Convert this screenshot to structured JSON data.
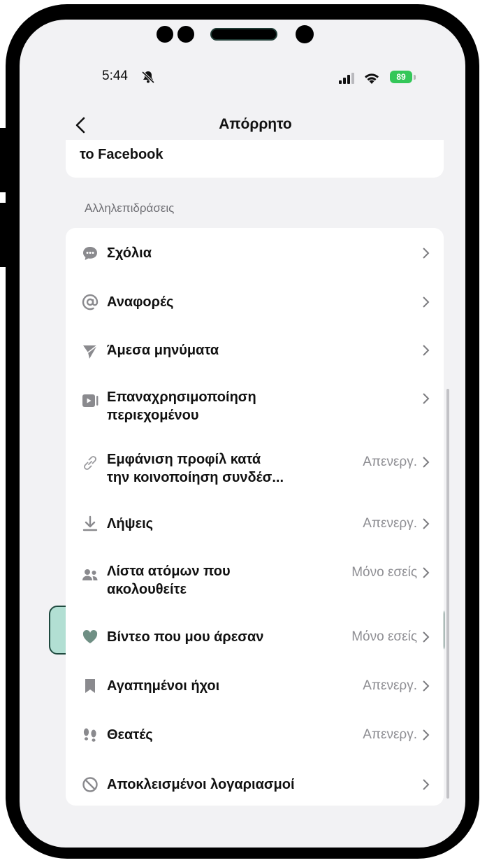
{
  "status_bar": {
    "time": "5:44",
    "battery": "89"
  },
  "nav": {
    "title": "Απόρρητο"
  },
  "top_card": {
    "text": "το Facebook"
  },
  "section": {
    "label": "Αλληλεπιδράσεις"
  },
  "rows": [
    {
      "label": "Σχόλια",
      "value": "",
      "icon": "comment-icon"
    },
    {
      "label": "Αναφορές",
      "value": "",
      "icon": "at-icon"
    },
    {
      "label": "Άμεσα μηνύματα",
      "value": "",
      "icon": "send-icon"
    },
    {
      "label": "Επαναχρησιμοποίηση\nπεριεχομένου",
      "value": "",
      "icon": "reuse-video-icon"
    },
    {
      "label": "Εμφάνιση προφίλ κατά\nτην κοινοποίηση συνδέσ...",
      "value": "Απενεργ.",
      "icon": "link-icon"
    },
    {
      "label": "Λήψεις",
      "value": "Απενεργ.",
      "icon": "download-icon"
    },
    {
      "label": "Λίστα ατόμων που\nακολουθείτε",
      "value": "Μόνο εσείς",
      "icon": "people-icon"
    },
    {
      "label": "Βίντεο που μου άρεσαν",
      "value": "Μόνο εσείς",
      "icon": "heart-icon"
    },
    {
      "label": "Αγαπημένοι ήχοι",
      "value": "Απενεργ.",
      "icon": "bookmark-icon"
    },
    {
      "label": "Θεατές",
      "value": "Απενεργ.",
      "icon": "footprints-icon"
    },
    {
      "label": "Αποκλεισμένοι λογαριασμοί",
      "value": "",
      "icon": "blocked-icon"
    }
  ],
  "colors": {
    "highlight": "#7ed0b8",
    "battery": "#34c759",
    "value_text": "#8e8e93"
  }
}
